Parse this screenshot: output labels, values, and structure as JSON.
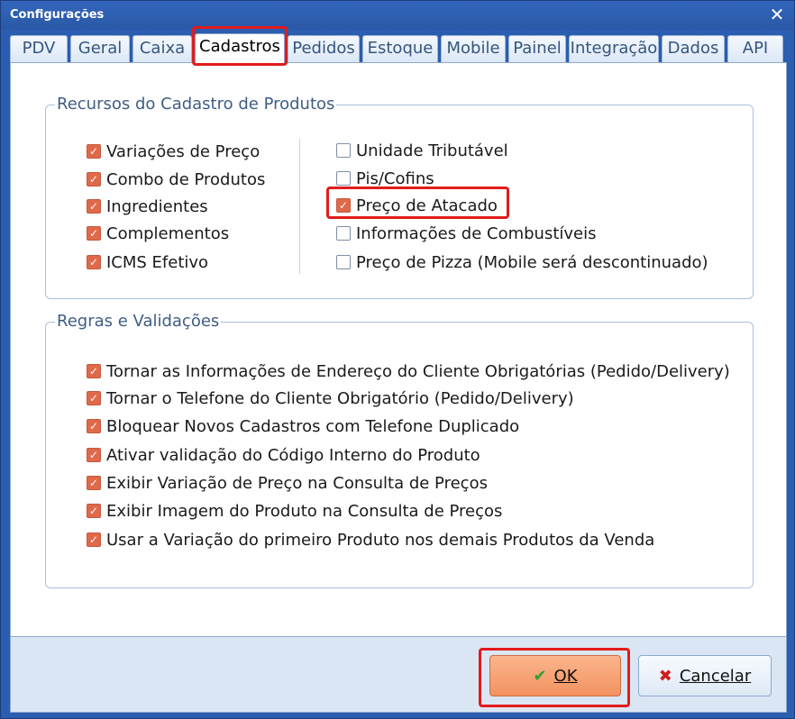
{
  "window": {
    "title": "Configurações",
    "close_symbol": "✕"
  },
  "tabs": [
    {
      "label": "PDV",
      "active": false
    },
    {
      "label": "Geral",
      "active": false
    },
    {
      "label": "Caixa",
      "active": false
    },
    {
      "label": "Cadastros",
      "active": true
    },
    {
      "label": "Pedidos",
      "active": false
    },
    {
      "label": "Estoque",
      "active": false
    },
    {
      "label": "Mobile",
      "active": false
    },
    {
      "label": "Painel",
      "active": false
    },
    {
      "label": "Integração",
      "active": false
    },
    {
      "label": "Dados",
      "active": false
    },
    {
      "label": "API",
      "active": false
    }
  ],
  "recursos": {
    "title": "Recursos do Cadastro de Produtos",
    "left": [
      {
        "label": "Variações de Preço",
        "checked": true
      },
      {
        "label": "Combo de Produtos",
        "checked": true
      },
      {
        "label": "Ingredientes",
        "checked": true
      },
      {
        "label": "Complementos",
        "checked": true
      },
      {
        "label": "ICMS Efetivo",
        "checked": true
      }
    ],
    "right": [
      {
        "label": "Unidade Tributável",
        "checked": false
      },
      {
        "label": "Pis/Cofins",
        "checked": false
      },
      {
        "label": "Preço de Atacado",
        "checked": true
      },
      {
        "label": "Informações de Combustíveis",
        "checked": false
      },
      {
        "label": "Preço de Pizza (Mobile será descontinuado)",
        "checked": false
      }
    ]
  },
  "regras": {
    "title": "Regras e Validações",
    "items": [
      {
        "label": "Tornar as Informações de Endereço do Cliente Obrigatórias (Pedido/Delivery)",
        "checked": true
      },
      {
        "label": "Tornar o Telefone do Cliente Obrigatório (Pedido/Delivery)",
        "checked": true
      },
      {
        "label": "Bloquear Novos Cadastros com Telefone Duplicado",
        "checked": true
      },
      {
        "label": "Ativar validação do Código Interno do Produto",
        "checked": true
      },
      {
        "label": "Exibir Variação de Preço na Consulta de Preços",
        "checked": true
      },
      {
        "label": "Exibir Imagem do Produto na Consulta de Preços",
        "checked": true
      },
      {
        "label": "Usar a Variação do primeiro Produto nos demais Produtos da Venda",
        "checked": true
      }
    ]
  },
  "buttons": {
    "ok_label": "OK",
    "ok_icon": "check-icon",
    "cancel_label": "Cancelar",
    "cancel_icon": "x-icon"
  },
  "colors": {
    "checkbox_checked": "#e0694a",
    "highlight_box": "#e21b1b",
    "ok_button": "#f3925f",
    "window_frame": "#2b5db0"
  }
}
